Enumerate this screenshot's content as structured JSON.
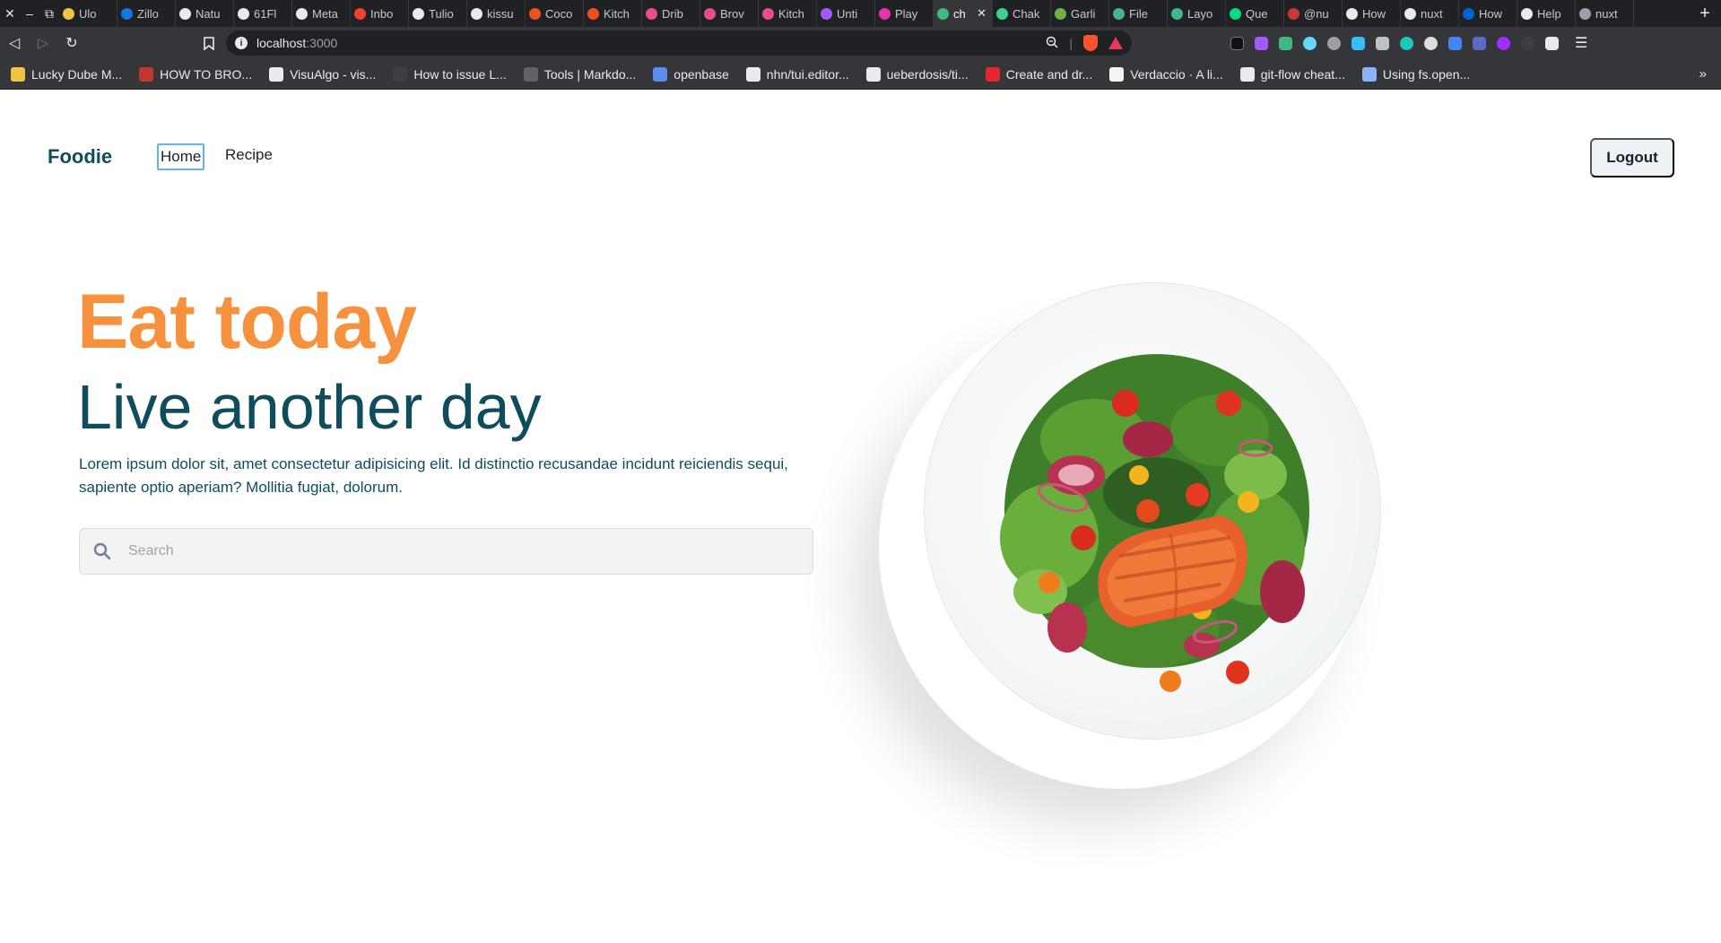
{
  "browser": {
    "tabs": [
      {
        "label": "Ulo",
        "color": "#f0c340"
      },
      {
        "label": "Zillo",
        "color": "#1277e1"
      },
      {
        "label": "Natu",
        "color": "#e8eaed"
      },
      {
        "label": "61Fl",
        "color": "#e8eaed"
      },
      {
        "label": "Meta",
        "color": "#e8eaed"
      },
      {
        "label": "Inbo",
        "color": "#ea4335"
      },
      {
        "label": "Tulio",
        "color": "#e8eaed"
      },
      {
        "label": "kissu",
        "color": "#e8eaed"
      },
      {
        "label": "Coco",
        "color": "#e95420"
      },
      {
        "label": "Kitch",
        "color": "#f24e1e"
      },
      {
        "label": "Drib",
        "color": "#ea4c89"
      },
      {
        "label": "Brov",
        "color": "#ea4c89"
      },
      {
        "label": "Kitch",
        "color": "#ea4c89"
      },
      {
        "label": "Unti",
        "color": "#a259ff"
      },
      {
        "label": "Play",
        "color": "#e535ab"
      },
      {
        "label": "ch",
        "color": "#41b883",
        "active": true
      },
      {
        "label": "Chak",
        "color": "#3ecf8e"
      },
      {
        "label": "Garli",
        "color": "#6db33f"
      },
      {
        "label": "File",
        "color": "#41b883"
      },
      {
        "label": "Layo",
        "color": "#41b883"
      },
      {
        "label": "Que",
        "color": "#00dc82"
      },
      {
        "label": "@nu",
        "color": "#cb3837"
      },
      {
        "label": "How",
        "color": "#e8eaed"
      },
      {
        "label": "nuxt",
        "color": "#e8eaed"
      },
      {
        "label": "How",
        "color": "#0064d2"
      },
      {
        "label": "Help",
        "color": "#e8eaed"
      },
      {
        "label": "nuxt",
        "color": "#9aa0a6"
      }
    ],
    "url_host": "localhost",
    "url_port": ":3000",
    "bookmarks": [
      {
        "label": "Lucky Dube M...",
        "color": "#f0c340"
      },
      {
        "label": "HOW TO BRO...",
        "color": "#c0392b"
      },
      {
        "label": "VisuAlgo - vis...",
        "color": "#e8eaed"
      },
      {
        "label": "How to issue L...",
        "color": "#3c4043"
      },
      {
        "label": "Tools | Markdo...",
        "color": "#5f6368"
      },
      {
        "label": "openbase",
        "color": "#5b8def"
      },
      {
        "label": "nhn/tui.editor...",
        "color": "#e8eaed"
      },
      {
        "label": "ueberdosis/ti...",
        "color": "#e8eaed"
      },
      {
        "label": "Create and dr...",
        "color": "#e3262f"
      },
      {
        "label": "Verdaccio · A li...",
        "color": "#f5f5f5"
      },
      {
        "label": "git-flow cheat...",
        "color": "#e8eaed"
      },
      {
        "label": "Using fs.open...",
        "color": "#8ab4f8"
      }
    ]
  },
  "nav": {
    "brand": "Foodie",
    "links": {
      "home": "Home",
      "recipe": "Recipe"
    },
    "logout": "Logout"
  },
  "hero": {
    "title": "Eat today",
    "subtitle": "Live another day",
    "text": "Lorem ipsum dolor sit, amet consectetur adipisicing elit. Id distinctio recusandae incidunt reiciendis sequi, sapiente optio aperiam? Mollitia fugiat, dolorum.",
    "search_placeholder": "Search"
  },
  "colors": {
    "accent_orange": "#f6913e",
    "brand_teal": "#0f4c5c"
  },
  "icons": {
    "search": "search-icon",
    "plate": "salad-plate-image"
  }
}
